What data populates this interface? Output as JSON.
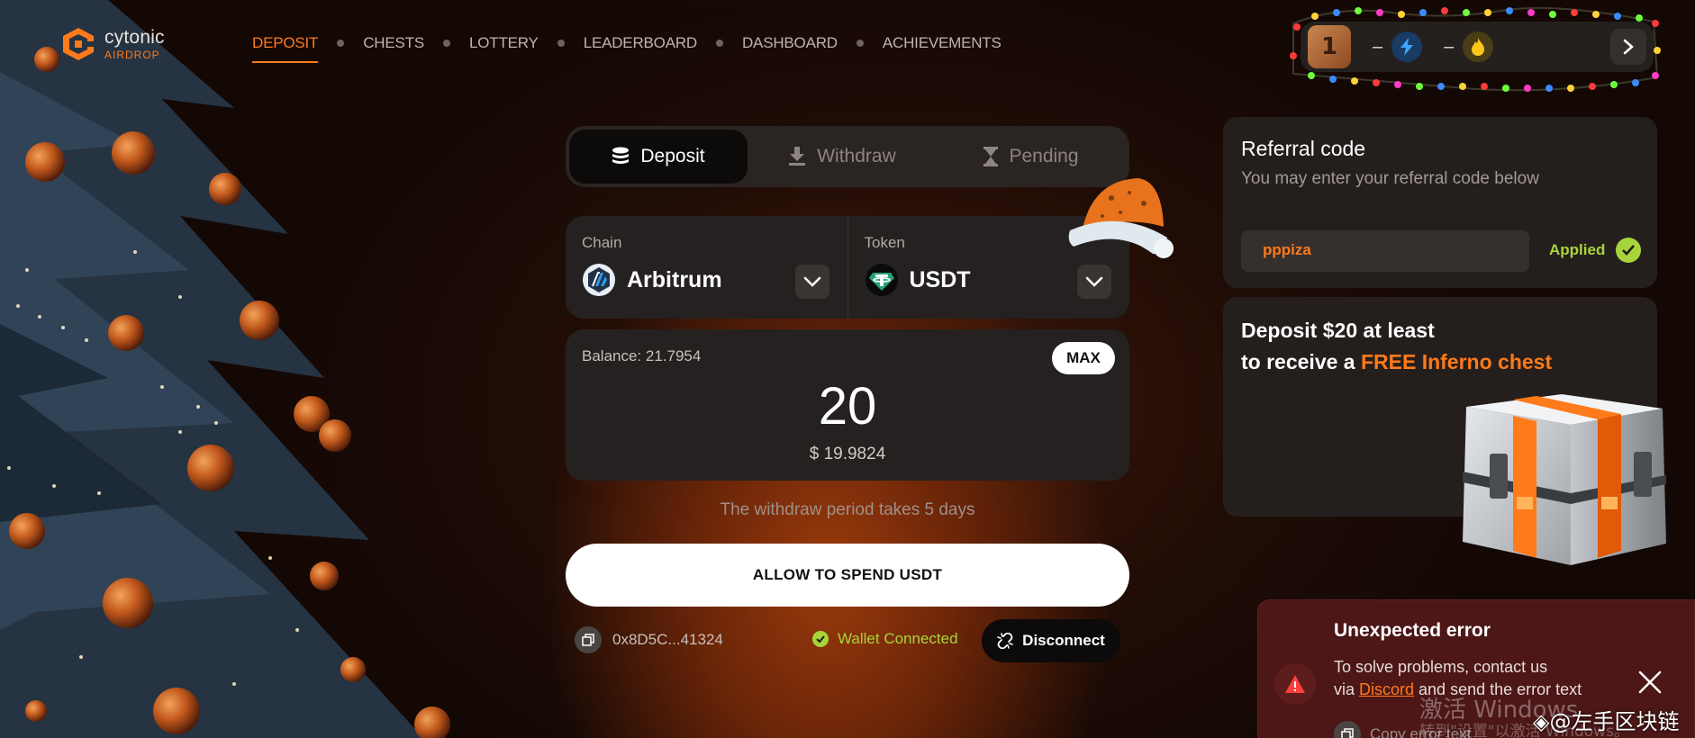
{
  "logo": {
    "word": "cytonic",
    "sub": "AIRDROP"
  },
  "nav": {
    "items": [
      {
        "label": "DEPOSIT",
        "active": true
      },
      {
        "label": "CHESTS"
      },
      {
        "label": "LOTTERY"
      },
      {
        "label": "LEADERBOARD"
      },
      {
        "label": "DASHBOARD"
      },
      {
        "label": "ACHIEVEMENTS"
      }
    ]
  },
  "stats": {
    "level": "1",
    "bolt_value": "–",
    "fire_value": "–"
  },
  "tabs": [
    {
      "label": "Deposit",
      "icon": "coins-icon",
      "active": true
    },
    {
      "label": "Withdraw",
      "icon": "download-icon"
    },
    {
      "label": "Pending",
      "icon": "hourglass-icon"
    }
  ],
  "chain": {
    "label": "Chain",
    "value": "Arbitrum"
  },
  "token": {
    "label": "Token",
    "value": "USDT"
  },
  "amount": {
    "balance": "Balance: 21.7954",
    "max_label": "MAX",
    "value": "20",
    "usd": "$ 19.9824"
  },
  "note": "The withdraw period takes 5 days",
  "allow_button": "ALLOW TO SPEND USDT",
  "wallet": {
    "address": "0x8D5C...41324",
    "status": "Wallet Connected",
    "disconnect_label": "Disconnect"
  },
  "referral": {
    "title": "Referral code",
    "subtitle": "You may enter your referral code below",
    "code": "pppiza",
    "status": "Applied"
  },
  "promo": {
    "line1": "Deposit $20 at least",
    "line2_prefix": "to receive a ",
    "line2_highlight": "FREE Inferno chest"
  },
  "error_toast": {
    "title": "Unexpected error",
    "line1": "To solve problems, contact us",
    "line2_prefix": "via ",
    "line2_link": "Discord",
    "line2_suffix": " and send the error text",
    "copy_label": "Copy error text"
  },
  "watermark": {
    "line1": "激活 Windows",
    "line2": "转到\"设置\"以激活 Windows。",
    "credit": "◈@左手区块链"
  },
  "colors": {
    "accent": "#ff7a1a",
    "success": "#a7d43a",
    "error_bg": "#4d1717"
  }
}
